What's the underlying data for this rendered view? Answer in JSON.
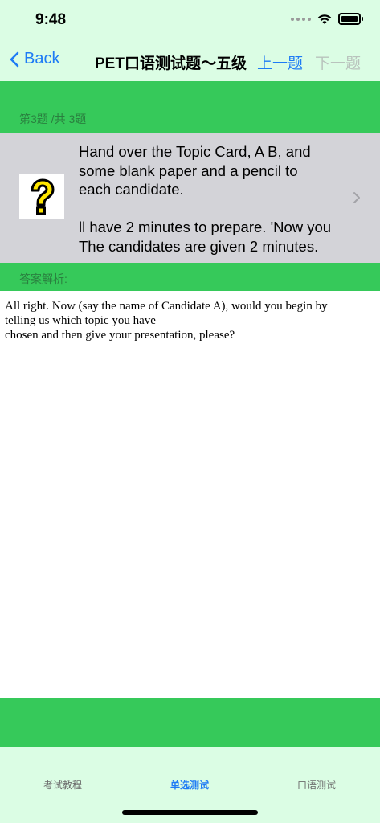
{
  "status": {
    "time": "9:48"
  },
  "nav": {
    "back_label": "Back",
    "title": "PET口语测试题～五级",
    "prev_label": "上一题",
    "next_label": "下一题"
  },
  "question": {
    "counter": "第3题 /共 3题",
    "lines": [
      "Hand over the Topic Card, A  B, and",
      "some blank paper and a pencil to",
      "each candidate.",
      "ll have 2 minutes to prepare. 'Now you",
      "The candidates are given 2 minutes."
    ]
  },
  "answer": {
    "label": "答案解析:",
    "lines": [
      "All right. Now (say the name of Candidate A), would you begin by",
      "telling us which topic you have",
      "chosen and then give your presentation, please?"
    ]
  },
  "tabs": [
    {
      "label": "考试教程"
    },
    {
      "label": "单选测试"
    },
    {
      "label": "口语测试"
    }
  ],
  "colors": {
    "accent": "#1e7bf5",
    "green": "#36c95a",
    "mint": "#dbfde4",
    "cell_gray": "#d3d3d8"
  }
}
